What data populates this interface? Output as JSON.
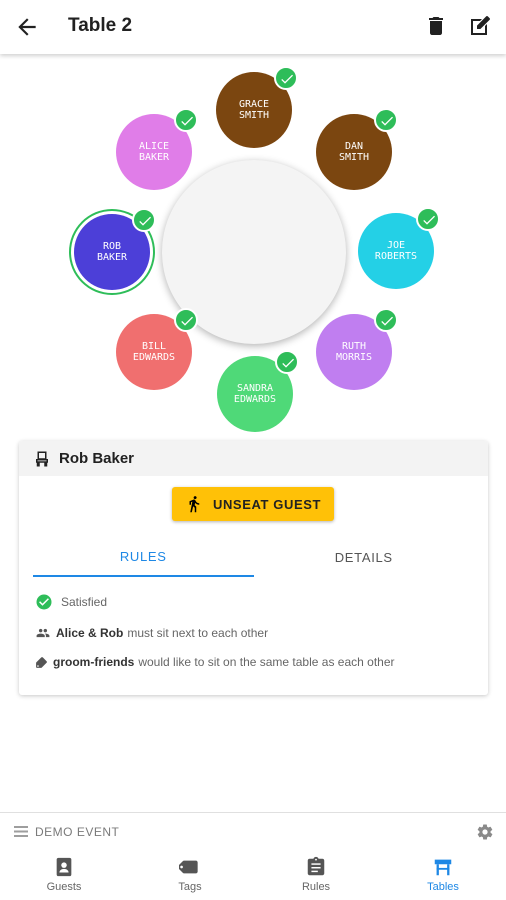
{
  "app_bar": {
    "title": "Table 2"
  },
  "seats": [
    {
      "label": "GRACE\nSMITH",
      "color": "#7b4610",
      "selected": false
    },
    {
      "label": "DAN\nSMITH",
      "color": "#7b4610",
      "selected": false
    },
    {
      "label": "ALICE\nBAKER",
      "color": "#e07de8",
      "selected": false
    },
    {
      "label": "ROB\nBAKER",
      "color": "#4c3fd8",
      "selected": true
    },
    {
      "label": "JOE\nROBERTS",
      "color": "#24d0e6",
      "selected": false
    },
    {
      "label": "BILL\nEDWARDS",
      "color": "#f06f6f",
      "selected": false
    },
    {
      "label": "RUTH\nMORRIS",
      "color": "#c07ef0",
      "selected": false
    },
    {
      "label": "SANDRA\nEDWARDS",
      "color": "#4fd978",
      "selected": false
    }
  ],
  "guest_card": {
    "name": "Rob Baker",
    "unseat_label": "UNSEAT GUEST",
    "tabs": [
      {
        "label": "RULES",
        "active": true
      },
      {
        "label": "DETAILS",
        "active": false
      }
    ],
    "status": "Satisfied",
    "rules": [
      {
        "bold": "Alice & Rob",
        "text": "must sit next to each other",
        "icon": "people-icon"
      },
      {
        "bold": "groom-friends",
        "text": "would like to sit on the same table as each other",
        "icon": "tag-icon"
      }
    ]
  },
  "event_bar": {
    "name": "DEMO EVENT"
  },
  "nav": [
    {
      "label": "Guests",
      "icon": "guests-icon",
      "active": false
    },
    {
      "label": "Tags",
      "icon": "tag-icon",
      "active": false
    },
    {
      "label": "Rules",
      "icon": "clipboard-icon",
      "active": false
    },
    {
      "label": "Tables",
      "icon": "table-icon",
      "active": true
    }
  ],
  "colors": {
    "accent": "#1e88e5",
    "check": "#2ebd59",
    "button": "#ffc107"
  }
}
